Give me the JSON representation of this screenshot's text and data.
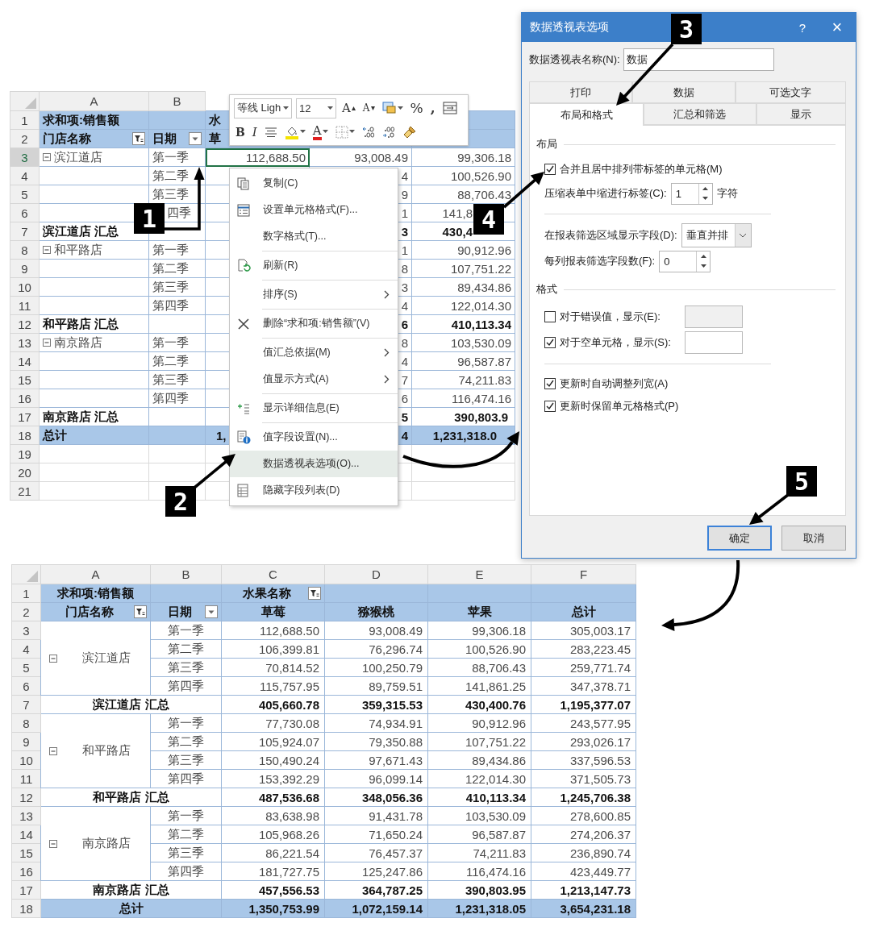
{
  "top_sheet": {
    "column_headers": [
      "A",
      "B"
    ],
    "rows": [
      {
        "row": "1",
        "kind": "title",
        "selected": false,
        "a": "求和项:销售额",
        "c": "水"
      },
      {
        "row": "2",
        "kind": "header",
        "selected": false,
        "a": "门店名称",
        "a_filtered": true,
        "b": "日期",
        "b_filtered": false,
        "c": "草"
      },
      {
        "row": "3",
        "kind": "item",
        "selected": true,
        "a": "滨江道店",
        "expanded": true,
        "b": "第一季",
        "c": "112,688.50",
        "d": "93,008.49",
        "e": "99,306.18"
      },
      {
        "row": "4",
        "kind": "item",
        "selected": false,
        "b": "第二季",
        "d": "4",
        "e": "100,526.90"
      },
      {
        "row": "5",
        "kind": "item",
        "selected": false,
        "b": "第三季",
        "d": "9",
        "e": "88,706.43"
      },
      {
        "row": "6",
        "kind": "item",
        "selected": false,
        "b": "四季",
        "d": "1",
        "e": "141,8"
      },
      {
        "row": "7",
        "kind": "subtotal",
        "selected": false,
        "a": "滨江道店 汇总",
        "d": "3",
        "e": "430,4"
      },
      {
        "row": "8",
        "kind": "item",
        "selected": false,
        "a": "和平路店",
        "expanded": true,
        "b": "第一季",
        "d": "1",
        "e": "90,912.96"
      },
      {
        "row": "9",
        "kind": "item",
        "selected": false,
        "b": "第二季",
        "d": "8",
        "e": "107,751.22"
      },
      {
        "row": "10",
        "kind": "item",
        "selected": false,
        "b": "第三季",
        "d": "3",
        "e": "89,434.86"
      },
      {
        "row": "11",
        "kind": "item",
        "selected": false,
        "b": "第四季",
        "d": "4",
        "e": "122,014.30"
      },
      {
        "row": "12",
        "kind": "subtotal",
        "selected": false,
        "a": "和平路店 汇总",
        "d": "6",
        "e": "410,113.34"
      },
      {
        "row": "13",
        "kind": "item",
        "selected": false,
        "a": "南京路店",
        "expanded": true,
        "b": "第一季",
        "d": "8",
        "e": "103,530.09"
      },
      {
        "row": "14",
        "kind": "item",
        "selected": false,
        "b": "第二季",
        "d": "4",
        "e": "96,587.87"
      },
      {
        "row": "15",
        "kind": "item",
        "selected": false,
        "b": "第三季",
        "d": "7",
        "e": "74,211.83"
      },
      {
        "row": "16",
        "kind": "item",
        "selected": false,
        "b": "第四季",
        "d": "6",
        "e": "116,474.16"
      },
      {
        "row": "17",
        "kind": "subtotal",
        "selected": false,
        "a": "南京路店 汇总",
        "d": "5",
        "e": "390,803.9"
      },
      {
        "row": "18",
        "kind": "total",
        "selected": false,
        "a": "总计",
        "c": "1,",
        "d": "4",
        "e": "1,231,318.0"
      },
      {
        "row": "19",
        "kind": "blank",
        "selected": false
      },
      {
        "row": "20",
        "kind": "blank",
        "selected": false
      },
      {
        "row": "21",
        "kind": "blank",
        "selected": false
      }
    ]
  },
  "mini_toolbar": {
    "font": "等线 Ligh",
    "size": "12",
    "row_1": [
      {
        "kind": "grow",
        "label": "A"
      },
      {
        "kind": "shrink",
        "label": "A"
      },
      {
        "kind": "styles"
      },
      {
        "kind": "percent",
        "label": "%"
      },
      {
        "kind": "comma",
        "label": ","
      },
      {
        "kind": "wrap"
      }
    ],
    "row_2": [
      {
        "kind": "bold",
        "label": "B"
      },
      {
        "kind": "italic",
        "label": "I"
      },
      {
        "kind": "align"
      },
      {
        "kind": "fill"
      },
      {
        "kind": "fontcolor",
        "label": "A"
      },
      {
        "kind": "borders"
      },
      {
        "kind": "moredecimals"
      },
      {
        "kind": "lessdecimals"
      },
      {
        "kind": "painter"
      }
    ]
  },
  "context_menu": {
    "groups": [
      [
        {
          "label": "复制(C)",
          "kind": "copy",
          "selected": false
        },
        {
          "label": "设置单元格格式(F)...",
          "kind": "cells",
          "selected": false
        },
        {
          "label": "数字格式(T)...",
          "kind": "plain",
          "selected": false
        }
      ],
      [
        {
          "label": "刷新(R)",
          "kind": "refresh",
          "selected": false
        }
      ],
      [
        {
          "label": "排序(S)",
          "kind": "submenu",
          "selected": false
        }
      ],
      [
        {
          "label": "删除“求和项:销售额”(V)",
          "kind": "remove",
          "selected": false
        }
      ],
      [
        {
          "label": "值汇总依据(M)",
          "kind": "submenu",
          "selected": false
        },
        {
          "label": "值显示方式(A)",
          "kind": "submenu",
          "selected": false
        }
      ],
      [
        {
          "label": "显示详细信息(E)",
          "kind": "expand",
          "selected": false
        }
      ],
      [
        {
          "label": "值字段设置(N)...",
          "kind": "field",
          "selected": false
        },
        {
          "label": "数据透视表选项(O)...",
          "kind": "plain",
          "selected": true
        },
        {
          "label": "隐藏字段列表(D)",
          "kind": "list",
          "selected": false
        }
      ]
    ]
  },
  "dialog": {
    "title": "数据透视表选项",
    "help": "?",
    "close": "×",
    "name_label": "数据透视表名称(N):",
    "name_value": "数据",
    "tabs_row_1": [
      {
        "label": "打印",
        "selected": false
      },
      {
        "label": "数据",
        "selected": false
      },
      {
        "label": "可选文字",
        "selected": false
      }
    ],
    "tabs_row_2": [
      {
        "label": "布局和格式",
        "selected": true
      },
      {
        "label": "汇总和筛选",
        "selected": false
      },
      {
        "label": "显示",
        "selected": false
      }
    ],
    "layout_section": {
      "title": "布局",
      "merge": {
        "label": "合并且居中排列带标签的单元格(M)",
        "checked": true
      },
      "indent": {
        "label": "压缩表单中缩进行标签(C):",
        "value": "1",
        "unit": "字符"
      },
      "filter_area": {
        "label": "在报表筛选区域显示字段(D):",
        "value": "垂直并排"
      },
      "filter_count": {
        "label": "每列报表筛选字段数(F):",
        "value": "0"
      }
    },
    "format_section": {
      "title": "格式",
      "error_values": {
        "label": "对于错误值，显示(E):",
        "checked": false
      },
      "empty_cells": {
        "label": "对于空单元格，显示(S):",
        "checked": true
      },
      "options": [
        {
          "label": "更新时自动调整列宽(A)",
          "checked": true
        },
        {
          "label": "更新时保留单元格格式(P)",
          "checked": true
        }
      ]
    },
    "buttons": [
      {
        "label": "确定",
        "default": true
      },
      {
        "label": "取消",
        "default": false
      }
    ]
  },
  "result_sheet": {
    "column_headers": [
      "A",
      "B",
      "C",
      "D",
      "E",
      "F"
    ],
    "title_row": {
      "row": "1",
      "label": "求和项:销售额",
      "field": "水果名称",
      "field_filtered": true
    },
    "header_row": {
      "row": "2",
      "row_field": "门店名称",
      "row_field_filtered": true,
      "date_field": "日期",
      "date_filtered": false,
      "columns": [
        "草莓",
        "猕猴桃",
        "苹果",
        "总计"
      ]
    },
    "groups": [
      {
        "store": "滨江道店",
        "expanded": true,
        "rows": [
          {
            "row": "3",
            "quarter": "第一季",
            "values": [
              "112,688.50",
              "93,008.49",
              "99,306.18",
              "305,003.17"
            ]
          },
          {
            "row": "4",
            "quarter": "第二季",
            "values": [
              "106,399.81",
              "76,296.74",
              "100,526.90",
              "283,223.45"
            ]
          },
          {
            "row": "5",
            "quarter": "第三季",
            "values": [
              "70,814.52",
              "100,250.79",
              "88,706.43",
              "259,771.74"
            ]
          },
          {
            "row": "6",
            "quarter": "第四季",
            "values": [
              "115,757.95",
              "89,759.51",
              "141,861.25",
              "347,378.71"
            ]
          }
        ],
        "subtotal": {
          "row": "7",
          "label": "滨江道店 汇总",
          "values": [
            "405,660.78",
            "359,315.53",
            "430,400.76",
            "1,195,377.07"
          ]
        }
      },
      {
        "store": "和平路店",
        "expanded": true,
        "rows": [
          {
            "row": "8",
            "quarter": "第一季",
            "values": [
              "77,730.08",
              "74,934.91",
              "90,912.96",
              "243,577.95"
            ]
          },
          {
            "row": "9",
            "quarter": "第二季",
            "values": [
              "105,924.07",
              "79,350.88",
              "107,751.22",
              "293,026.17"
            ]
          },
          {
            "row": "10",
            "quarter": "第三季",
            "values": [
              "150,490.24",
              "97,671.43",
              "89,434.86",
              "337,596.53"
            ]
          },
          {
            "row": "11",
            "quarter": "第四季",
            "values": [
              "153,392.29",
              "96,099.14",
              "122,014.30",
              "371,505.73"
            ]
          }
        ],
        "subtotal": {
          "row": "12",
          "label": "和平路店 汇总",
          "values": [
            "487,536.68",
            "348,056.36",
            "410,113.34",
            "1,245,706.38"
          ]
        }
      },
      {
        "store": "南京路店",
        "expanded": true,
        "rows": [
          {
            "row": "13",
            "quarter": "第一季",
            "values": [
              "83,638.98",
              "91,431.78",
              "103,530.09",
              "278,600.85"
            ]
          },
          {
            "row": "14",
            "quarter": "第二季",
            "values": [
              "105,968.26",
              "71,650.24",
              "96,587.87",
              "274,206.37"
            ]
          },
          {
            "row": "15",
            "quarter": "第三季",
            "values": [
              "86,221.54",
              "76,457.37",
              "74,211.83",
              "236,890.74"
            ]
          },
          {
            "row": "16",
            "quarter": "第四季",
            "values": [
              "181,727.75",
              "125,247.86",
              "116,474.16",
              "423,449.77"
            ]
          }
        ],
        "subtotal": {
          "row": "17",
          "label": "南京路店 汇总",
          "values": [
            "457,556.53",
            "364,787.25",
            "390,803.95",
            "1,213,147.73"
          ]
        }
      }
    ],
    "total": {
      "row": "18",
      "label": "总计",
      "values": [
        "1,350,753.99",
        "1,072,159.14",
        "1,231,318.05",
        "3,654,231.18"
      ]
    }
  },
  "callouts": [
    "1",
    "2",
    "3",
    "4",
    "5"
  ]
}
